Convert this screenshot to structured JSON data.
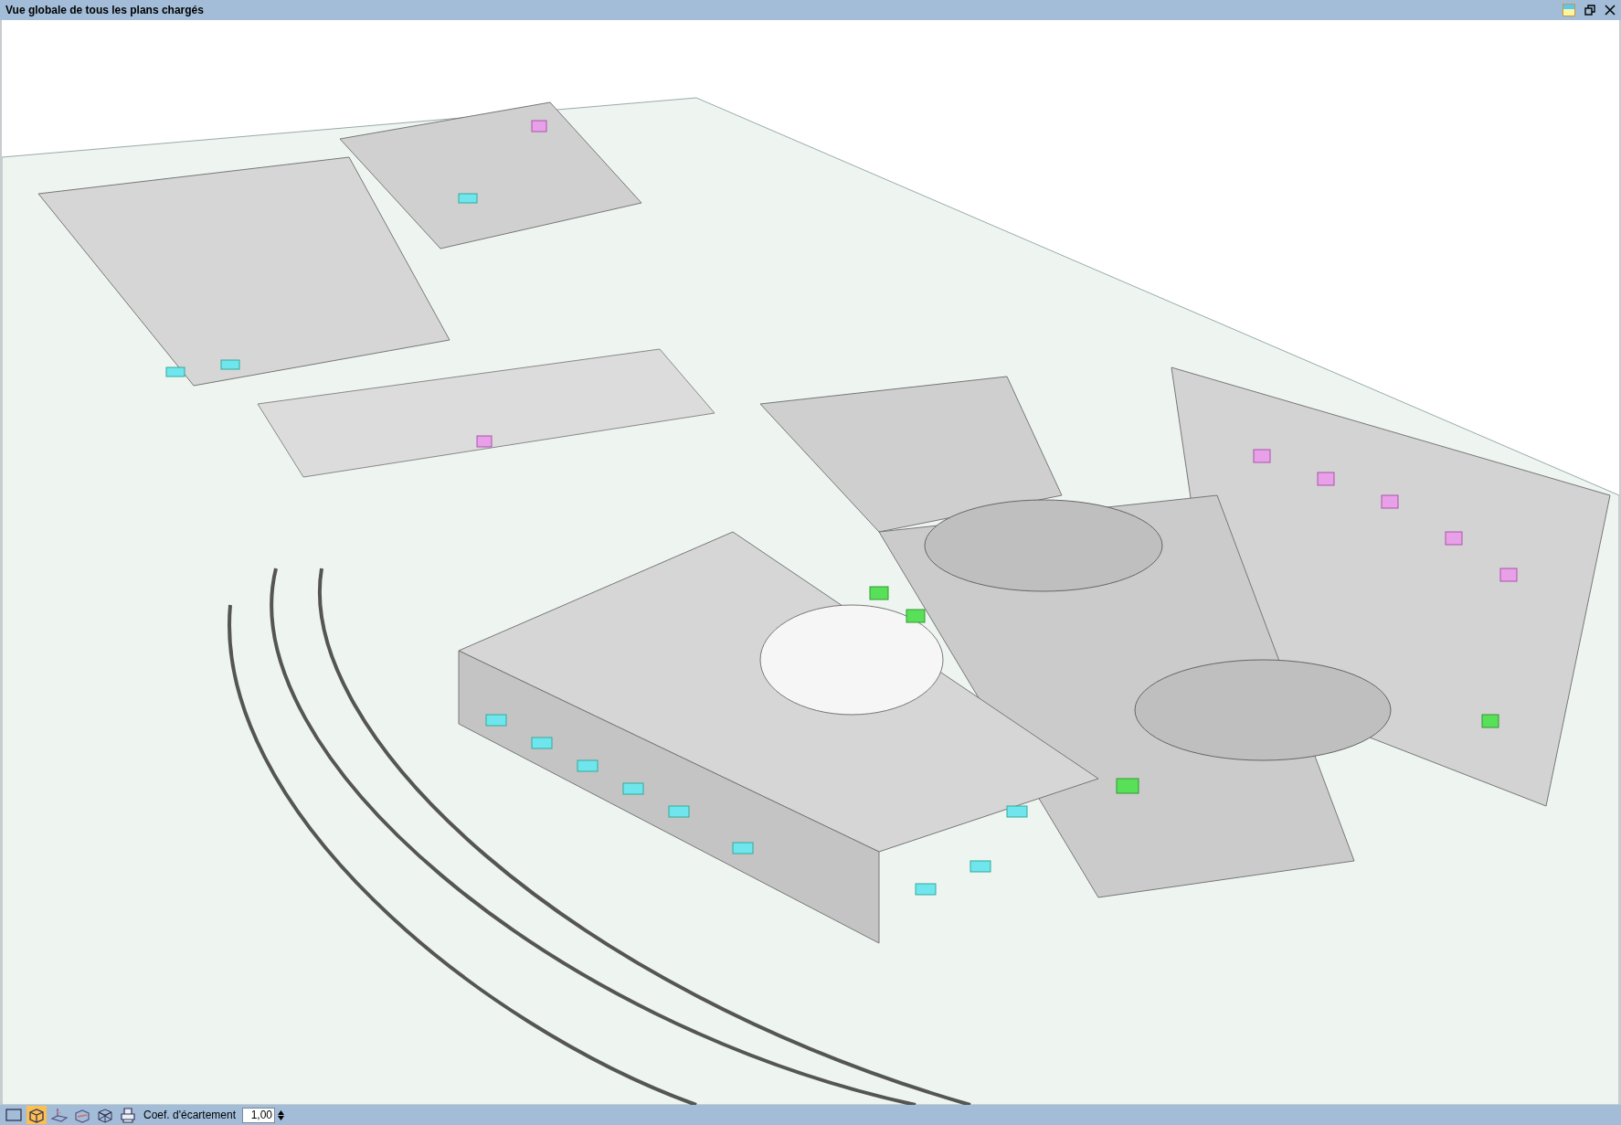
{
  "window": {
    "title": "Vue globale de tous les plans chargés"
  },
  "toolbar": {
    "buttons": [
      {
        "kind": "plan",
        "selected": false
      },
      {
        "kind": "box",
        "selected": true
      },
      {
        "kind": "plane",
        "selected": false
      },
      {
        "kind": "section",
        "selected": false
      },
      {
        "kind": "wire",
        "selected": false
      },
      {
        "kind": "print",
        "selected": false
      }
    ],
    "spacing": {
      "label": "Coef. d'écartement",
      "value": "1,00"
    }
  }
}
